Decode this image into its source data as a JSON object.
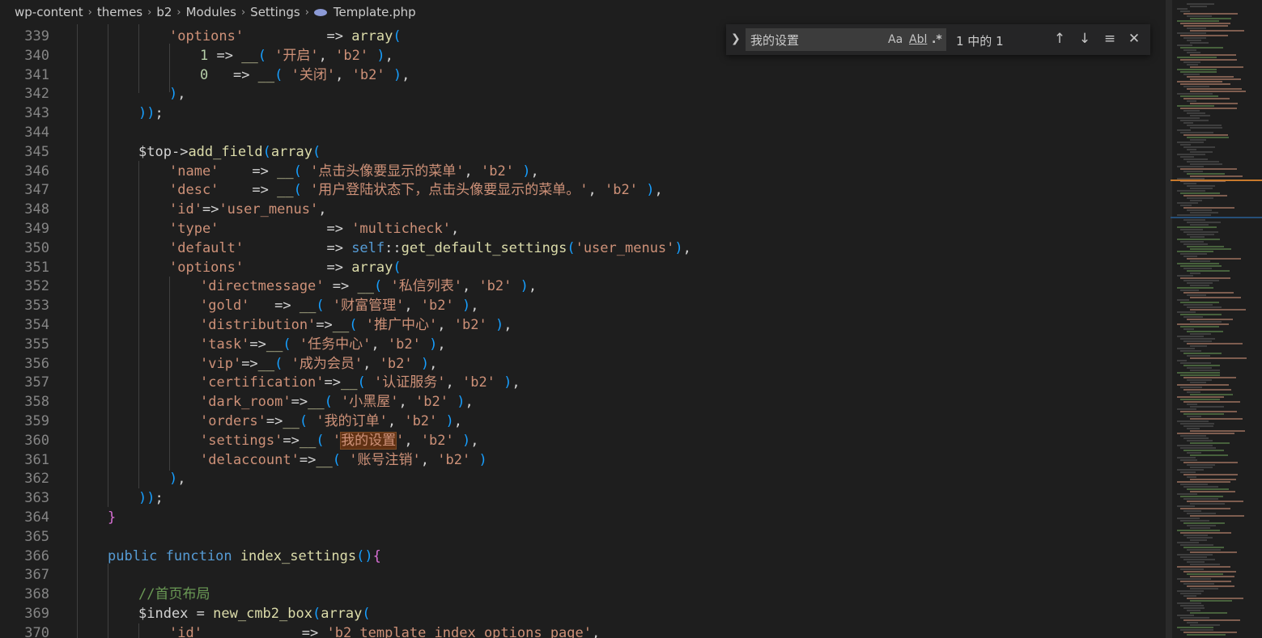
{
  "breadcrumb": {
    "items": [
      "wp-content",
      "themes",
      "b2",
      "Modules",
      "Settings"
    ],
    "file": "Template.php",
    "separator": ">"
  },
  "find_widget": {
    "query": "我的设置",
    "match_case_label": "Aa",
    "whole_word_label": "Abl",
    "regex_label": ".*",
    "result_count": "1 中的 1",
    "prev_icon": "arrow-up-icon",
    "next_icon": "arrow-down-icon",
    "selection_icon": "find-in-selection-icon",
    "close_icon": "close-icon"
  },
  "colors": {
    "background": "#1e1e1e",
    "string": "#ce9178",
    "keyword": "#569cd6",
    "comment": "#6a9955",
    "function": "#dcdcaa",
    "match_highlight": "#613214"
  },
  "lines": [
    {
      "n": "339",
      "code": "'options'          => array("
    },
    {
      "n": "340",
      "code": "1 => __( '开启', 'b2' ),"
    },
    {
      "n": "341",
      "code": "0   => __( '关闭', 'b2' ),"
    },
    {
      "n": "342",
      "code": "),"
    },
    {
      "n": "343",
      "code": "));"
    },
    {
      "n": "344",
      "code": ""
    },
    {
      "n": "345",
      "code": "$top->add_field(array("
    },
    {
      "n": "346",
      "code": "'name'    => __( '点击头像要显示的菜单', 'b2' ),"
    },
    {
      "n": "347",
      "code": "'desc'    => __( '用户登陆状态下，点击头像要显示的菜单。', 'b2' ),"
    },
    {
      "n": "348",
      "code": "'id'=>'user_menus',"
    },
    {
      "n": "349",
      "code": "'type'             => 'multicheck',"
    },
    {
      "n": "350",
      "code": "'default'          => self::get_default_settings('user_menus'),"
    },
    {
      "n": "351",
      "code": "'options'          => array("
    },
    {
      "n": "352",
      "code": "'directmessage' => __( '私信列表', 'b2' ),"
    },
    {
      "n": "353",
      "code": "'gold'   => __( '财富管理', 'b2' ),"
    },
    {
      "n": "354",
      "code": "'distribution'=>__( '推广中心', 'b2' ),"
    },
    {
      "n": "355",
      "code": "'task'=>__( '任务中心', 'b2' ),"
    },
    {
      "n": "356",
      "code": "'vip'=>__( '成为会员', 'b2' ),"
    },
    {
      "n": "357",
      "code": "'certification'=>__( '认证服务', 'b2' ),"
    },
    {
      "n": "358",
      "code": "'dark_room'=>__( '小黑屋', 'b2' ),"
    },
    {
      "n": "359",
      "code": "'orders'=>__( '我的订单', 'b2' ),"
    },
    {
      "n": "360",
      "code": "'settings'=>__( '我的设置', 'b2' ),"
    },
    {
      "n": "361",
      "code": "'delaccount'=>__( '账号注销', 'b2' )"
    },
    {
      "n": "362",
      "code": "),"
    },
    {
      "n": "363",
      "code": "));"
    },
    {
      "n": "364",
      "code": "}"
    },
    {
      "n": "365",
      "code": ""
    },
    {
      "n": "366",
      "code": "public function index_settings(){"
    },
    {
      "n": "367",
      "code": ""
    },
    {
      "n": "368",
      "code": "//首页布局"
    },
    {
      "n": "369",
      "code": "$index = new_cmb2_box(array("
    },
    {
      "n": "370",
      "code": "'id'            => 'b2_template_index_options_page',"
    }
  ]
}
